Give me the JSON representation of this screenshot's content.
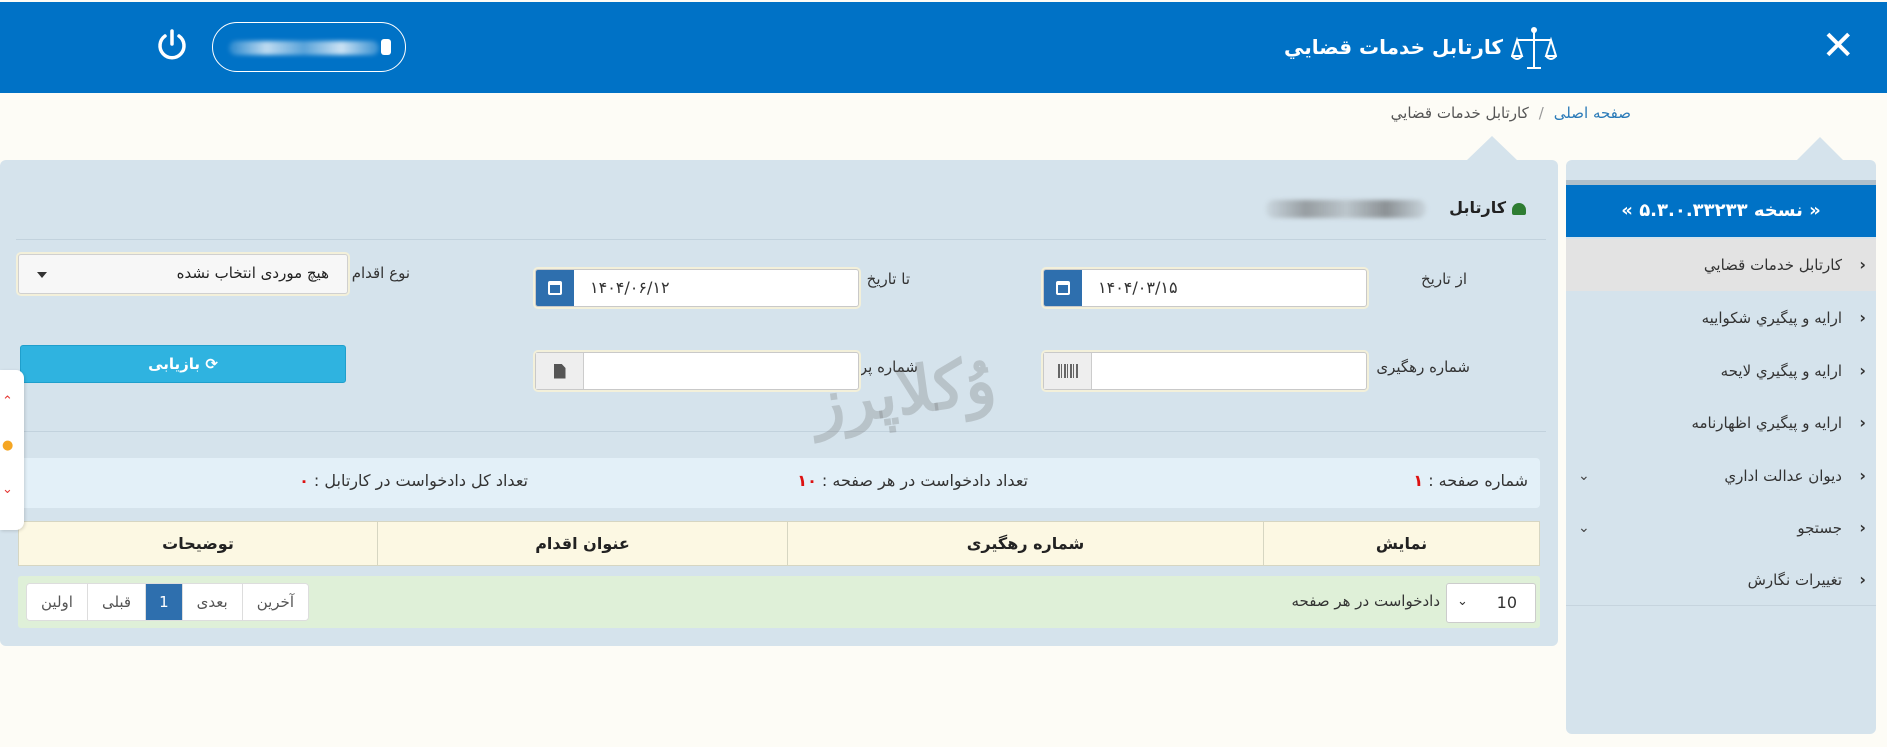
{
  "header": {
    "app_title": "کارتابل خدمات قضايي",
    "close_symbol": "✕",
    "icons": [
      "justice-scale-icon",
      "user-icon",
      "power-icon",
      "close-icon"
    ]
  },
  "breadcrumb": {
    "home": "صفحه اصلی",
    "separator": "/",
    "current": "کارتابل خدمات قضايي"
  },
  "sidebar": {
    "version": "« نسخه ۵.۳.۰.۳۳۲۳۳ »",
    "items": [
      {
        "label": "کارتابل خدمات قضايي",
        "active": true,
        "expandable": false
      },
      {
        "label": "ارايه و پيگيري شکواييه",
        "active": false,
        "expandable": false
      },
      {
        "label": "ارايه و پيگيري لايحه",
        "active": false,
        "expandable": false
      },
      {
        "label": "ارايه و پيگيري اظهارنامه",
        "active": false,
        "expandable": false
      },
      {
        "label": "ديوان عدالت اداري",
        "active": false,
        "expandable": true
      },
      {
        "label": "جستجو",
        "active": false,
        "expandable": true
      },
      {
        "label": "تغييرات نگارش",
        "active": false,
        "expandable": false
      }
    ]
  },
  "panel": {
    "title": "کارتابل",
    "filters": {
      "from_date_label": "از تاریخ",
      "from_date_value": "۱۴۰۴/۰۳/۱۵",
      "to_date_label": "تا تاریخ",
      "to_date_value": "۱۴۰۴/۰۶/۱۲",
      "action_type_label": "نوع اقدام",
      "action_type_value": "هیچ موردی انتخاب نشده",
      "tracking_label": "شماره رهگیری",
      "tracking_value": "",
      "file_label": "شماره پرونده",
      "file_value": "",
      "refresh_button": "بازیابی",
      "refresh_icon": "⟳"
    },
    "info": {
      "page_number_label": "شماره صفحه :",
      "page_number": "۱",
      "per_page_label": "تعداد دادخواست در هر صفحه :",
      "per_page": "۱۰",
      "total_label": "تعداد کل دادخواست در کارتابل :",
      "total": "۰"
    },
    "table": {
      "columns": [
        "نمایش",
        "شماره رهگیری",
        "عنوان اقدام",
        "توضیحات"
      ]
    },
    "pagination": {
      "per_page_select": "10",
      "per_page_text": "دادخواست در هر صفحه",
      "first": "اولین",
      "prev": "قبلی",
      "current": "1",
      "next": "بعدی",
      "last": "آخرین"
    }
  },
  "watermark": "وُکلاپرز",
  "colors": {
    "primary": "#0072c6",
    "panel_bg": "#d5e3ec",
    "search_button": "#2fb3e0",
    "table_header": "#fcf8e3",
    "pager_bg": "#dff0d8",
    "accent_number": "#dd1111"
  }
}
